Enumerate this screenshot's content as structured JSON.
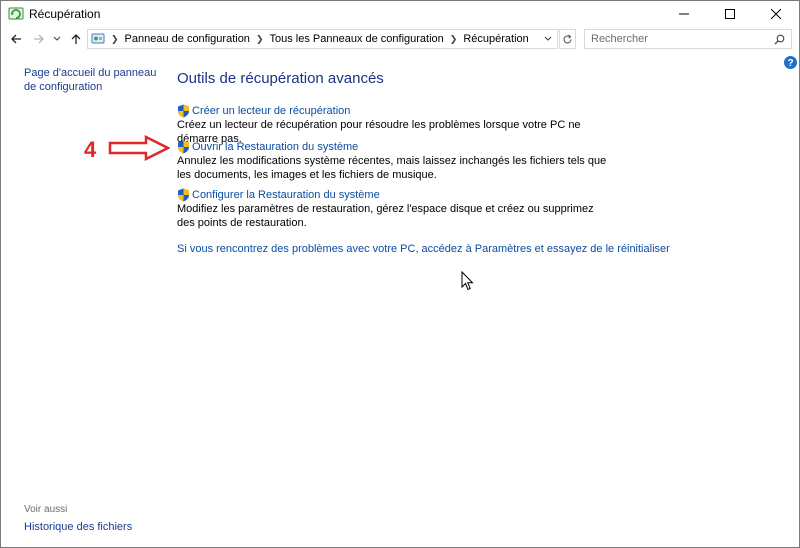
{
  "window": {
    "title": "Récupération",
    "icons": {
      "app": "recovery-icon",
      "minimize": "minimize-icon",
      "maximize": "maximize-icon",
      "close": "close-icon"
    }
  },
  "nav": {
    "back": "back-arrow-icon",
    "forward": "forward-arrow-icon",
    "recent": "chevron-down-icon",
    "up": "up-arrow-icon",
    "breadcrumbs": [
      "Panneau de configuration",
      "Tous les Panneaux de configuration",
      "Récupération"
    ],
    "search_placeholder": "Rechercher"
  },
  "left": {
    "home_link": "Page d'accueil du panneau de configuration",
    "see_also_label": "Voir aussi",
    "history_link": "Historique des fichiers"
  },
  "main": {
    "heading": "Outils de récupération avancés",
    "tasks": [
      {
        "title": "Créer un lecteur de récupération",
        "description": "Créez un lecteur de récupération pour résoudre les problèmes lorsque votre PC ne démarre pas."
      },
      {
        "title": "Ouvrir la Restauration du système",
        "description": "Annulez les modifications système récentes, mais laissez inchangés les fichiers tels que les documents, les images et les fichiers de musique."
      },
      {
        "title": "Configurer la Restauration du système",
        "description": "Modifiez les paramètres de restauration, gérez l'espace disque et créez ou supprimez des points de restauration."
      }
    ],
    "reset_link": "Si vous rencontrez des problèmes avec votre PC, accédez à Paramètres et essayez de le réinitialiser"
  },
  "annotation": {
    "step_number": "4",
    "arrow_color": "#e02727"
  },
  "colors": {
    "link": "#0b4da2",
    "heading": "#1e3287",
    "shield_blue": "#1f5fbf",
    "shield_yellow": "#f2c21b"
  }
}
